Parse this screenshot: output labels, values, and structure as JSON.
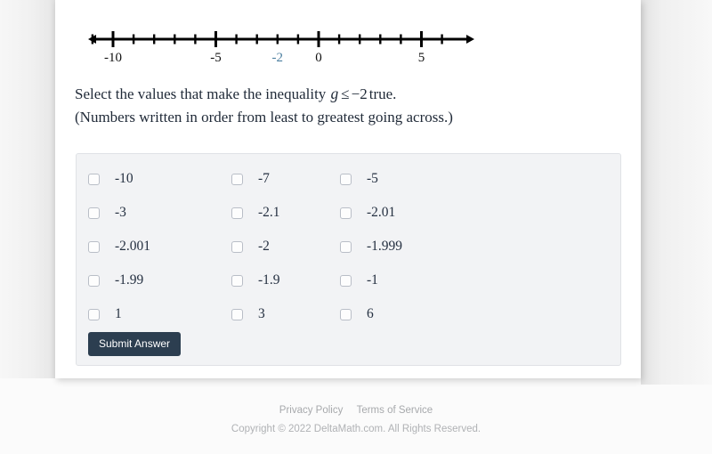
{
  "numberline": {
    "min": -11.5,
    "max": 6.6,
    "tick_min": -11,
    "tick_max": 6,
    "labeled_ticks": [
      {
        "value": -10,
        "label": "-10",
        "color": "#111111"
      },
      {
        "value": -5,
        "label": "-5",
        "color": "#111111"
      },
      {
        "value": -2,
        "label": "-2",
        "color": "#4c7fa0"
      },
      {
        "value": 0,
        "label": "0",
        "color": "#111111"
      },
      {
        "value": 5,
        "label": "5",
        "color": "#111111"
      }
    ],
    "major_ticks": [
      -10,
      -5,
      0,
      5
    ],
    "line_color": "#000000",
    "highlight_color": "#4c7fa0"
  },
  "prompt": {
    "line1_before": "Select the values that make the inequality",
    "variable": "g",
    "operator": "≤",
    "value": "−2",
    "line1_after": "true.",
    "line2": "(Numbers written in order from least to greatest going across.)"
  },
  "choices": {
    "rows": [
      [
        {
          "label": "-10",
          "checked": false
        },
        {
          "label": "-7",
          "checked": false
        },
        {
          "label": "-5",
          "checked": false
        }
      ],
      [
        {
          "label": "-3",
          "checked": false
        },
        {
          "label": "-2.1",
          "checked": false
        },
        {
          "label": "-2.01",
          "checked": false
        }
      ],
      [
        {
          "label": "-2.001",
          "checked": false
        },
        {
          "label": "-2",
          "checked": false
        },
        {
          "label": "-1.999",
          "checked": false
        }
      ],
      [
        {
          "label": "-1.99",
          "checked": false
        },
        {
          "label": "-1.9",
          "checked": false
        },
        {
          "label": "-1",
          "checked": false
        }
      ],
      [
        {
          "label": "1",
          "checked": false
        },
        {
          "label": "3",
          "checked": false
        },
        {
          "label": "6",
          "checked": false
        }
      ]
    ]
  },
  "actions": {
    "submit_label": "Submit Answer"
  },
  "footer": {
    "privacy_policy": "Privacy Policy",
    "terms_of_service": "Terms of Service",
    "copyright": "Copyright © 2022 DeltaMath.com. All Rights Reserved."
  },
  "colors": {
    "button_bg": "#2c3e50",
    "panel_bg": "#f2f3f5",
    "panel_border": "#e0e2e6",
    "text": "#1f2937",
    "highlight": "#4c7fa0",
    "footer_text": "#a7a9ac"
  }
}
